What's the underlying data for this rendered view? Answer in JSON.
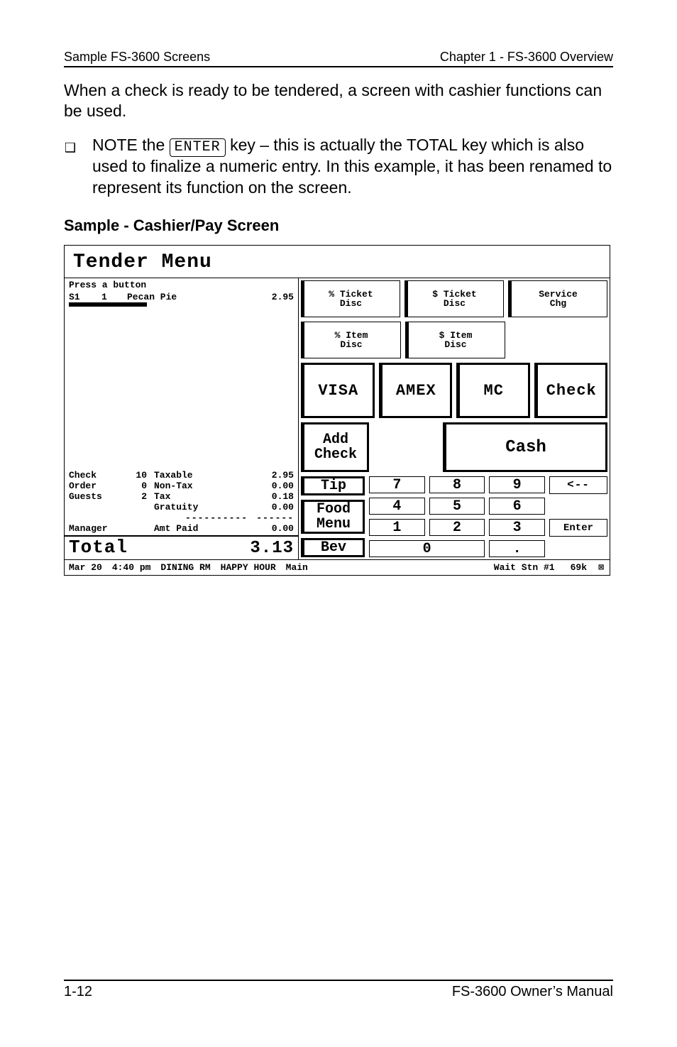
{
  "header": {
    "left": "Sample FS-3600 Screens",
    "right": "Chapter 1 - FS-3600 Overview"
  },
  "paragraph1": "When a check is ready to be tendered, a screen with cashier functions can be used.",
  "bullet": {
    "pre": "NOTE the ",
    "key": "ENTER",
    "post": " key – this is actually the TOTAL key which is also used to finalize a numeric entry.  In this example, it has been renamed to represent its function on the screen."
  },
  "heading2": "Sample - Cashier/Pay Screen",
  "screen": {
    "title": "Tender Menu",
    "prompt": "Press a button",
    "item": {
      "seat": "S1",
      "qty": "1",
      "name": "Pecan Pie",
      "price": "2.95"
    },
    "summary": {
      "check": {
        "label": "Check",
        "val1": "10",
        "name": "Taxable",
        "amt": "2.95"
      },
      "order": {
        "label": "Order",
        "val1": "0",
        "name": "Non-Tax",
        "amt": "0.00"
      },
      "guests": {
        "label": "Guests",
        "val1": "2",
        "name": "Tax",
        "amt": "0.18"
      },
      "gratuity": {
        "name": "Gratuity",
        "amt": "0.00"
      },
      "manager": {
        "label": "Manager",
        "name": "Amt Paid",
        "amt": "0.00"
      },
      "total_label": "Total",
      "total_value": "3.13"
    },
    "buttons": {
      "pct_ticket": "% Ticket\nDisc",
      "dol_ticket": "$ Ticket\nDisc",
      "service": "Service\nChg",
      "pct_item": "% Item\nDisc",
      "dol_item": "$ Item\nDisc",
      "visa": "VISA",
      "amex": "AMEX",
      "mc": "MC",
      "check": "Check",
      "add_check": "Add\nCheck",
      "cash": "Cash",
      "tip": "Tip",
      "food": "Food\nMenu",
      "bev": "Bev",
      "enter": "Enter",
      "back": "<--",
      "dot": "."
    },
    "numpad": {
      "k0": "0",
      "k1": "1",
      "k2": "2",
      "k3": "3",
      "k4": "4",
      "k5": "5",
      "k6": "6",
      "k7": "7",
      "k8": "8",
      "k9": "9"
    },
    "status": {
      "date": "Mar 20",
      "time": "4:40 pm",
      "room": "DINING RM",
      "mode": "HAPPY HOUR",
      "screen": "Main",
      "station": "Wait Stn #1",
      "mem": "69k"
    }
  },
  "footer": {
    "left": "1-12",
    "right": "FS-3600 Owner’s Manual"
  }
}
